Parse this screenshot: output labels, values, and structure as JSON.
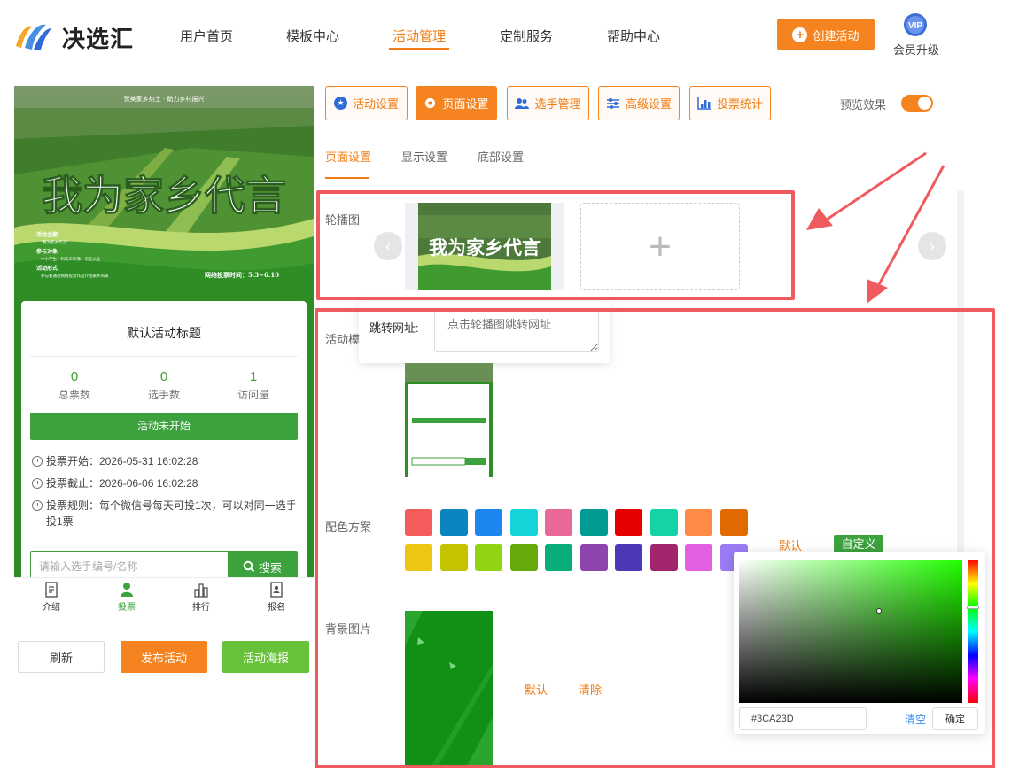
{
  "app": {
    "name": "决选汇"
  },
  "nav": {
    "items": [
      {
        "label": "用户首页"
      },
      {
        "label": "模板中心"
      },
      {
        "label": "活动管理"
      },
      {
        "label": "定制服务"
      },
      {
        "label": "帮助中心"
      }
    ],
    "active_index": 2
  },
  "header": {
    "create_label": "创建活动",
    "vip_icon_text": "VIP",
    "vip_label": "会员升级"
  },
  "preview": {
    "banner": {
      "top_line": "赞美家乡热土 · 助力乡村振兴",
      "headline": "我为家乡代言",
      "theme_title": "活动主题",
      "theme_text": "\"我为家乡代言\"",
      "participants_title": "参与对象",
      "participants_text": "中小学生、科技工作者、农业从业",
      "form_title": "活动形式",
      "form_text": "参与者通过网络投票作品介绍家乡风采",
      "vote_time": "网络投票时间：5.3~6.10"
    },
    "card": {
      "title": "默认活动标题",
      "stats": [
        {
          "value": "0",
          "label": "总票数"
        },
        {
          "value": "0",
          "label": "选手数"
        },
        {
          "value": "1",
          "label": "访问量"
        }
      ],
      "status": "活动未开始",
      "start": "投票开始：2026-05-31 16:02:28",
      "end": "投票截止：2026-06-06 16:02:28",
      "rules": "投票规则：每个微信号每天可投1次，可以对同一选手投1票",
      "search_placeholder": "请输入选手编号/名称",
      "search_label": "搜索"
    },
    "tabs": [
      {
        "label": "介绍"
      },
      {
        "label": "投票"
      },
      {
        "label": "排行"
      },
      {
        "label": "报名"
      }
    ],
    "active_tab": 1
  },
  "actions": {
    "refresh": "刷新",
    "publish": "发布活动",
    "poster": "活动海报"
  },
  "settings": {
    "top_tabs": [
      {
        "label": "活动设置",
        "icon": "star-icon"
      },
      {
        "label": "页面设置",
        "icon": "gear-icon"
      },
      {
        "label": "选手管理",
        "icon": "users-icon"
      },
      {
        "label": "高级设置",
        "icon": "sliders-icon"
      },
      {
        "label": "投票统计",
        "icon": "bar-chart-icon"
      }
    ],
    "active_top_tab": 1,
    "preview_label": "预览效果",
    "preview_on": true,
    "sub_tabs": [
      {
        "label": "页面设置"
      },
      {
        "label": "显示设置"
      },
      {
        "label": "底部设置"
      }
    ],
    "active_sub_tab": 0,
    "carousel_label": "轮播图",
    "link_label": "跳转网址:",
    "link_placeholder": "点击轮播图跳转网址",
    "template_label": "活动模",
    "color_label": "配色方案",
    "color_default": "默认",
    "color_custom": "自定义",
    "swatches_row1": [
      "#f45b5b",
      "#0b84c0",
      "#1e86f0",
      "#14d4d9",
      "#e8689a",
      "#009b93",
      "#e60000",
      "#14d4a6",
      "#ff8a45",
      "#e06a00"
    ],
    "swatches_row2": [
      "#ecc615",
      "#c5c200",
      "#91d414",
      "#63aa0a",
      "#08ad7a",
      "#8e44ad",
      "#4b39b7",
      "#a3266c",
      "#e35ee1",
      "#9b7cf5"
    ],
    "bg_label": "背景图片",
    "bg_default": "默认",
    "bg_clear": "清除",
    "picker": {
      "hex": "#3CA23D",
      "clear": "清空",
      "confirm": "确定"
    }
  }
}
